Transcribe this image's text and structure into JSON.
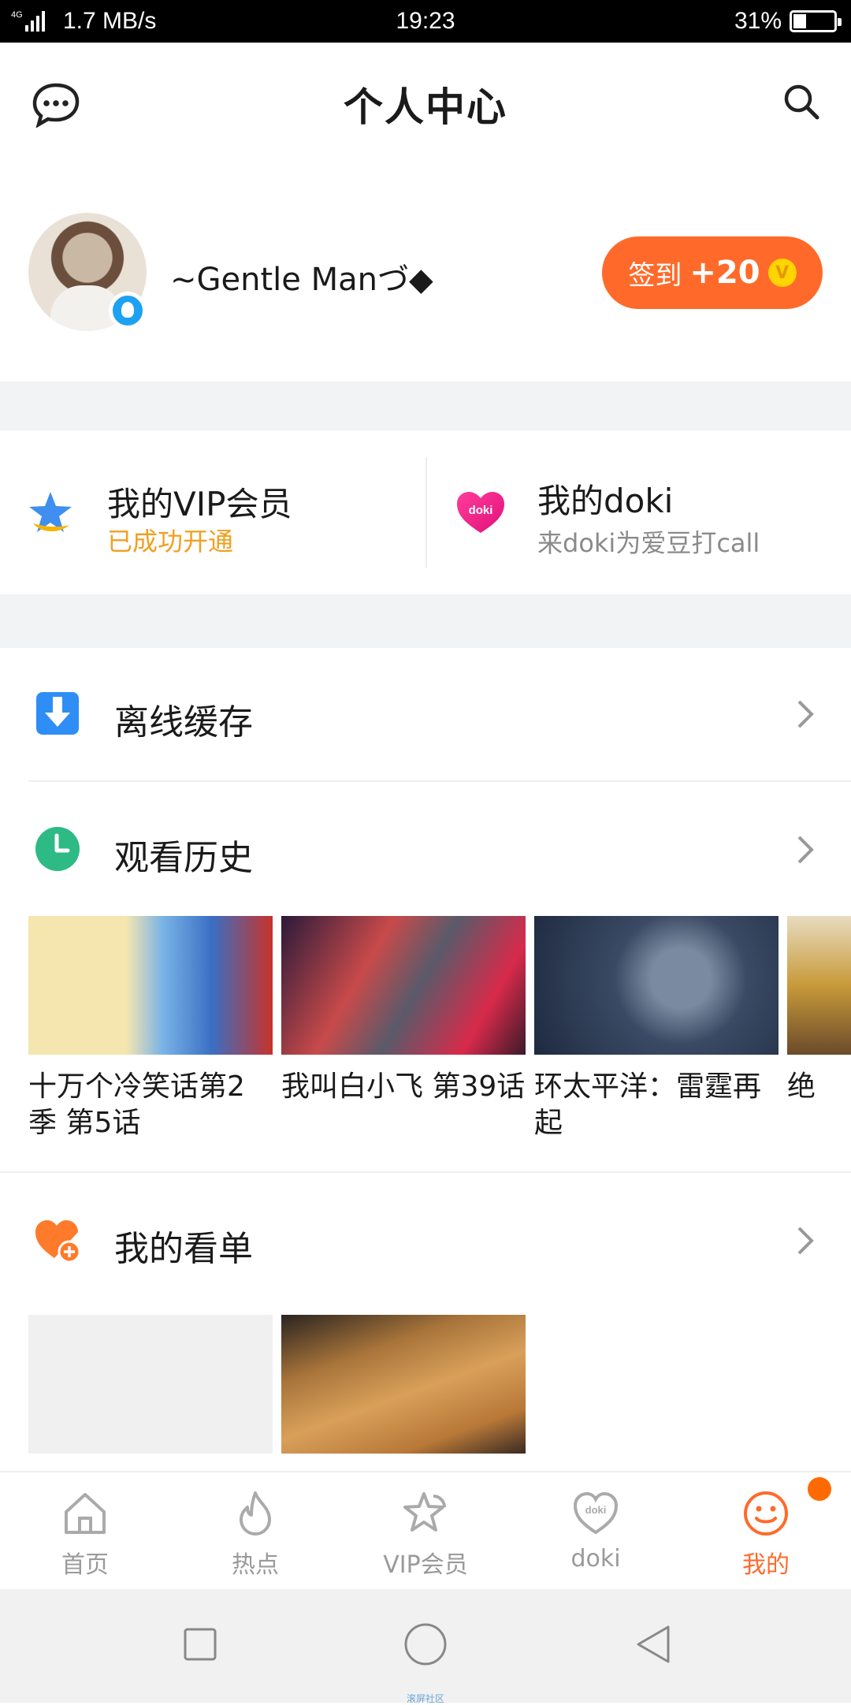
{
  "status_bar": {
    "network": "4G",
    "speed": "1.7 MB/s",
    "time": "19:23",
    "battery": "31%"
  },
  "header": {
    "title": "个人中心"
  },
  "profile": {
    "nickname": "~Gentle Manづ◆",
    "checkin_label": "签到",
    "checkin_points": "+20",
    "coin_symbol": "V"
  },
  "cards": {
    "vip": {
      "title": "我的VIP会员",
      "subtitle": "已成功开通",
      "subtitle_color": "#f0a020"
    },
    "doki": {
      "title": "我的doki",
      "subtitle": "来doki为爱豆打call",
      "icon_text": "doki"
    }
  },
  "rows": {
    "offline": {
      "label": "离线缓存"
    },
    "history": {
      "label": "观看历史"
    },
    "watchlist": {
      "label": "我的看单"
    }
  },
  "history_items": [
    {
      "caption": "十万个冷笑话第2季 第5话"
    },
    {
      "caption": "我叫白小飞 第39话"
    },
    {
      "caption": "环太平洋：雷霆再起"
    },
    {
      "caption": "绝"
    }
  ],
  "bottom_nav": [
    {
      "label": "首页",
      "icon": "home-icon"
    },
    {
      "label": "热点",
      "icon": "flame-icon"
    },
    {
      "label": "VIP会员",
      "icon": "vip-star-icon"
    },
    {
      "label": "doki",
      "icon": "doki-heart-icon"
    },
    {
      "label": "我的",
      "icon": "smiley-icon",
      "active": true
    }
  ],
  "system_nav": {
    "brand": "滚屏社区"
  },
  "colors": {
    "accent": "#ff6a2a",
    "vip_gold": "#f0a020",
    "history_green": "#2dba84",
    "download_blue": "#2f8ef5",
    "watchlist_orange": "#ff7a2a"
  }
}
